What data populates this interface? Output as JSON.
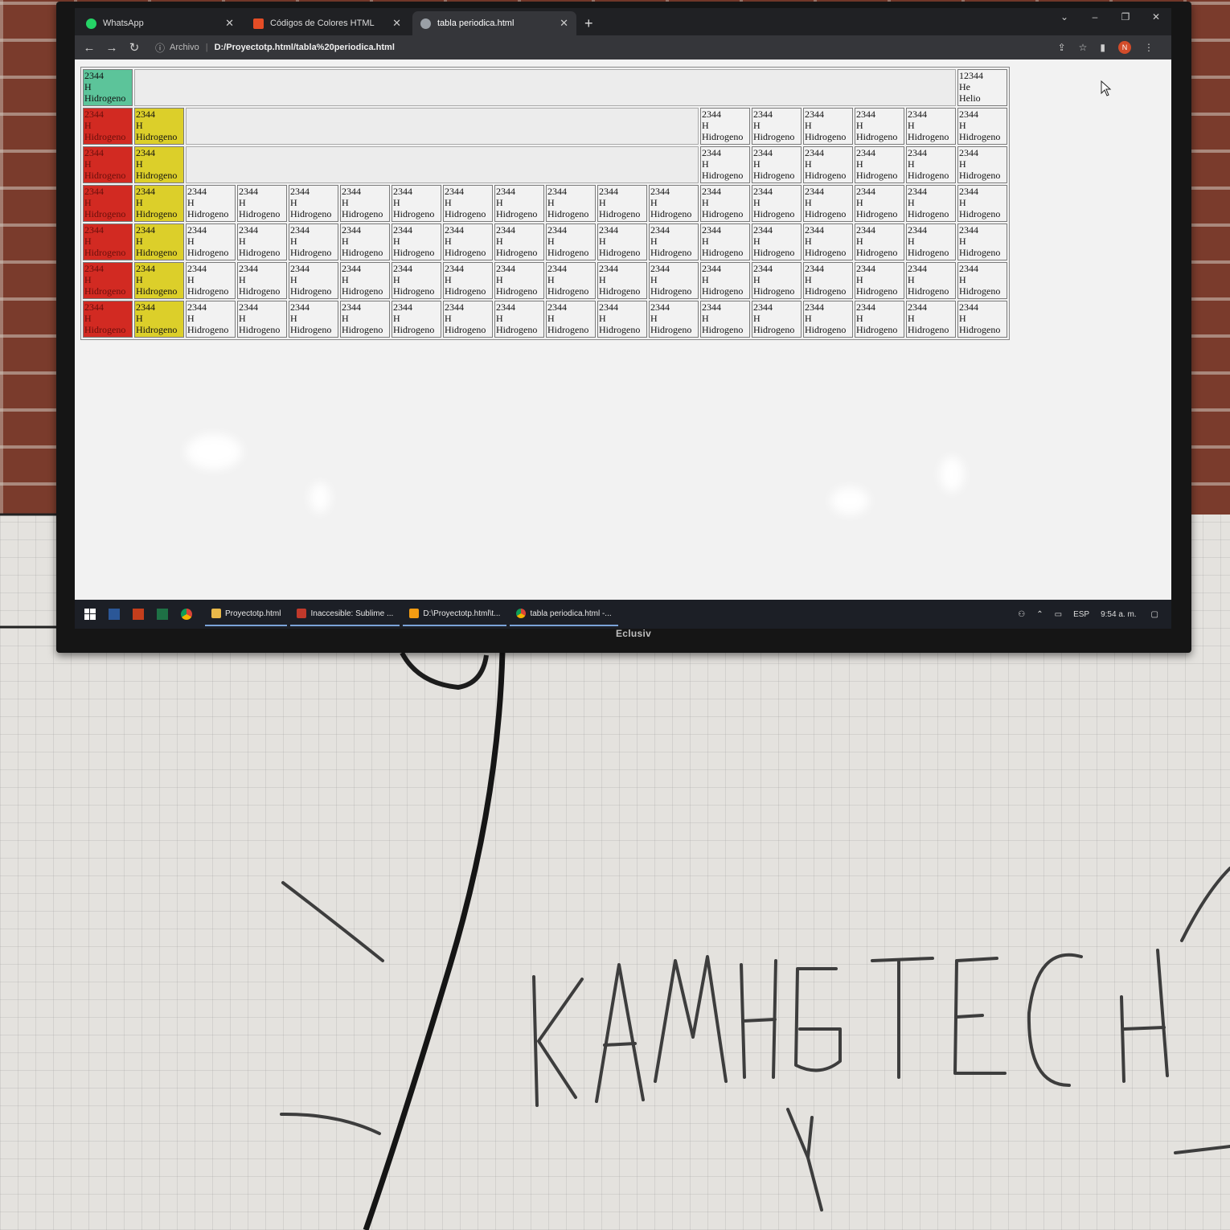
{
  "browser": {
    "tabs": [
      {
        "title": "WhatsApp",
        "icon": "whatsapp-icon",
        "active": false
      },
      {
        "title": "Códigos de Colores HTML",
        "icon": "html-colors-site-icon",
        "active": false
      },
      {
        "title": "tabla periodica.html",
        "icon": "globe-icon",
        "active": true
      }
    ],
    "new_tab": "+",
    "address": {
      "scheme_label": "Archivo",
      "url": "D:/Proyectotp.html/tabla%20periodica.html"
    },
    "profile_initial": "N"
  },
  "periodic_table": {
    "helium": {
      "number": "12344",
      "symbol": "He",
      "name": "Helio"
    },
    "cell": {
      "number": "2344",
      "symbol": "H",
      "name": "Hidrogeno"
    },
    "colors": {
      "hydrogen": "#5cc49a",
      "group1": "#d22a22",
      "group2": "#dccf2a",
      "other": "#f2f2f2"
    }
  },
  "taskbar": {
    "apps": [
      {
        "label": "Proyectotp.html",
        "icon": "folder-icon"
      },
      {
        "label": "Inaccesible: Sublime ...",
        "icon": "sublime-icon"
      },
      {
        "label": "D:\\Proyectotp.html\\t...",
        "icon": "sublime-text-icon"
      },
      {
        "label": "tabla periodica.html -...",
        "icon": "chrome-icon"
      }
    ],
    "language": "ESP",
    "time": "9:54 a. m."
  },
  "monitor": {
    "brand": "Eclusiv"
  },
  "whiteboard": {
    "handwritten_text": "KAMHETECH",
    "handwritten_letter": "Y"
  }
}
